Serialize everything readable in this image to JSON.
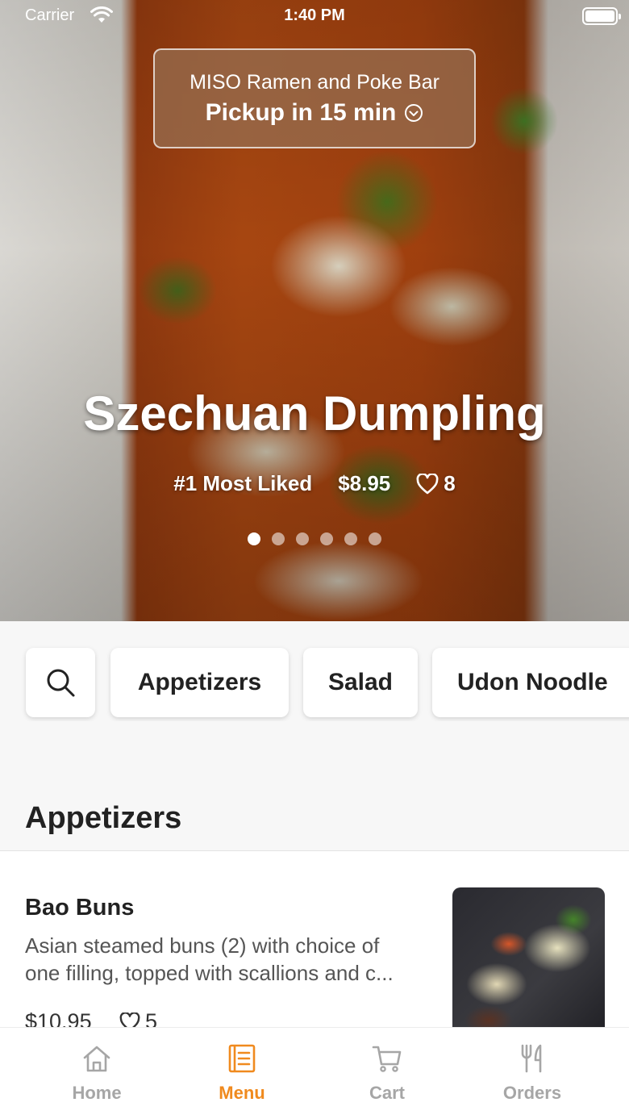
{
  "status_bar": {
    "carrier": "Carrier",
    "time": "1:40 PM"
  },
  "pickup": {
    "restaurant": "MISO Ramen and Poke Bar",
    "time_label": "Pickup in 15 min"
  },
  "featured": {
    "title": "Szechuan Dumpling",
    "rank": "#1 Most Liked",
    "price": "$8.95",
    "likes": "8",
    "slide_count": 6,
    "active_slide": 0
  },
  "categories": [
    "Appetizers",
    "Salad",
    "Udon Noodle"
  ],
  "section": {
    "title": "Appetizers"
  },
  "items": [
    {
      "name": "Bao Buns",
      "desc_line1": "Asian steamed buns (2) with choice of",
      "desc_line2": "one filling, topped with scallions and c...",
      "price": "$10.95",
      "likes": "5"
    }
  ],
  "tabs": [
    {
      "label": "Home",
      "icon": "home-icon",
      "active": false
    },
    {
      "label": "Menu",
      "icon": "menu-book-icon",
      "active": true
    },
    {
      "label": "Cart",
      "icon": "cart-icon",
      "active": false
    },
    {
      "label": "Orders",
      "icon": "fork-knife-icon",
      "active": false
    }
  ],
  "colors": {
    "accent": "#f08a1e",
    "inactive": "#a6a6a6"
  }
}
